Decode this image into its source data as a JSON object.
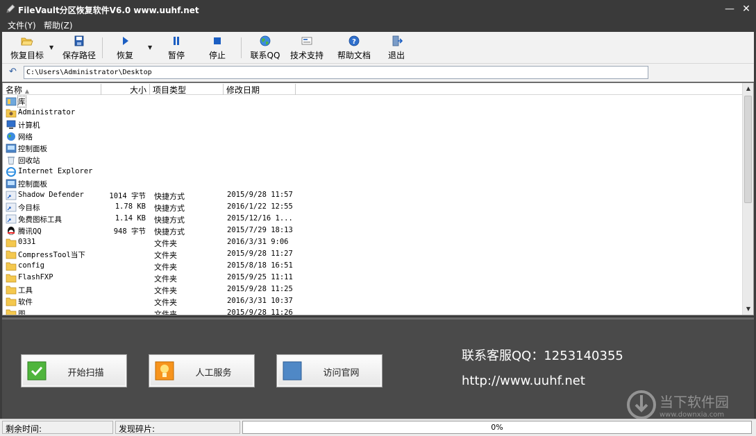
{
  "window": {
    "title": "FileVault分区恢复软件V6.0 www.uuhf.net",
    "minimize_glyph": "—",
    "close_glyph": "✕"
  },
  "menu": [
    "文件(Y)",
    "帮助(Z)"
  ],
  "toolbar": {
    "restore_target": "恢复目标",
    "save_path": "保存路径",
    "restore": "恢复",
    "pause": "暂停",
    "stop": "停止",
    "contact_qq": "联系QQ",
    "tech_support": "技术支持",
    "help_docs": "帮助文档",
    "exit": "退出"
  },
  "address": {
    "path": "C:\\Users\\Administrator\\Desktop"
  },
  "columns": {
    "name": "名称",
    "size": "大小",
    "type": "项目类型",
    "modified": "修改日期"
  },
  "files": [
    {
      "icon": "library-icon",
      "name": "库",
      "size": "",
      "type": "",
      "modified": ""
    },
    {
      "icon": "user-folder-icon",
      "name": "Administrator",
      "size": "",
      "type": "",
      "modified": ""
    },
    {
      "icon": "computer-icon",
      "name": "计算机",
      "size": "",
      "type": "",
      "modified": ""
    },
    {
      "icon": "network-icon",
      "name": "网络",
      "size": "",
      "type": "",
      "modified": ""
    },
    {
      "icon": "control-panel-icon",
      "name": "控制面板",
      "size": "",
      "type": "",
      "modified": ""
    },
    {
      "icon": "recycle-bin-icon",
      "name": "回收站",
      "size": "",
      "type": "",
      "modified": ""
    },
    {
      "icon": "internet-explorer-icon",
      "name": "Internet Explorer",
      "size": "",
      "type": "",
      "modified": ""
    },
    {
      "icon": "control-panel-icon",
      "name": "控制面板",
      "size": "",
      "type": "",
      "modified": ""
    },
    {
      "icon": "shortcut-icon",
      "name": "Shadow Defender",
      "size": "1014 字节",
      "type": "快捷方式",
      "modified": "2015/9/28 11:57"
    },
    {
      "icon": "shortcut-icon",
      "name": "今目标",
      "size": "1.78 KB",
      "type": "快捷方式",
      "modified": "2016/1/22 12:55"
    },
    {
      "icon": "shortcut-icon",
      "name": "免费图标工具",
      "size": "1.14 KB",
      "type": "快捷方式",
      "modified": "2015/12/16 1..."
    },
    {
      "icon": "qq-icon",
      "name": "腾讯QQ",
      "size": "948 字节",
      "type": "快捷方式",
      "modified": "2015/7/29 18:13"
    },
    {
      "icon": "folder-icon",
      "name": "0331",
      "size": "",
      "type": "文件夹",
      "modified": "2016/3/31 9:06"
    },
    {
      "icon": "folder-icon",
      "name": "CompressTool当下",
      "size": "",
      "type": "文件夹",
      "modified": "2015/9/28 11:27"
    },
    {
      "icon": "folder-icon",
      "name": "config",
      "size": "",
      "type": "文件夹",
      "modified": "2015/8/18 16:51"
    },
    {
      "icon": "folder-icon",
      "name": "FlashFXP",
      "size": "",
      "type": "文件夹",
      "modified": "2015/9/25 11:11"
    },
    {
      "icon": "folder-icon",
      "name": "工具",
      "size": "",
      "type": "文件夹",
      "modified": "2015/9/28 11:25"
    },
    {
      "icon": "folder-icon",
      "name": "软件",
      "size": "",
      "type": "文件夹",
      "modified": "2016/3/31 10:37"
    },
    {
      "icon": "folder-icon",
      "name": "图",
      "size": "",
      "type": "文件夹",
      "modified": "2015/9/28 11:26"
    }
  ],
  "actions": {
    "start_scan": "开始扫描",
    "manual_service": "人工服务",
    "visit_site": "访问官网"
  },
  "contact": {
    "qq_line": "联系客服QQ：1253140355",
    "url": "http://www.uuhf.net"
  },
  "status": {
    "time_left": "剩余时间:",
    "fragments_found": "发现碎片:",
    "progress_fraction": 0,
    "progress_text": "0%"
  },
  "watermark": {
    "cn": "当下软件园",
    "en": "www.downxia.com"
  },
  "colors": {
    "panel": "#4a4a4a",
    "titlebar": "#3a3a3a",
    "toolbar": "#f2f2f2",
    "progress": "#3d8ee0"
  }
}
